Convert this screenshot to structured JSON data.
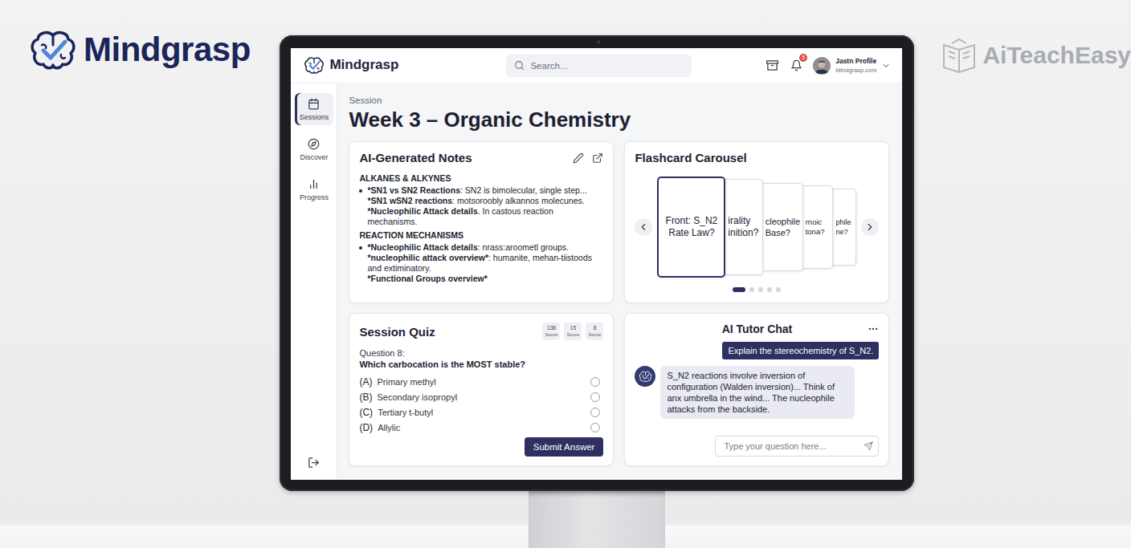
{
  "brand": {
    "name": "Mindgrasp"
  },
  "watermark": {
    "name": "AiTeachEasy"
  },
  "header": {
    "logo": "Mindgrasp",
    "search_placeholder": "Search...",
    "notifications": "5",
    "profile": {
      "name": "Jastn Profile",
      "domain": "Mindgrasp.com"
    }
  },
  "sidebar": {
    "items": [
      {
        "label": "Sessions",
        "selected": true
      },
      {
        "label": "Discover",
        "selected": false
      },
      {
        "label": "Progress",
        "selected": false
      }
    ]
  },
  "session": {
    "eyebrow": "Session",
    "title": "Week 3 – Organic Chemistry"
  },
  "notes": {
    "title": "AI-Generated Notes",
    "sections": [
      {
        "heading": "ALKANES & ALKYNES",
        "lines": [
          {
            "bold": "*SN1 vs SN2 Reactions",
            "text": ": SN2 is bimolecular, single step..."
          },
          {
            "bold": "*SN1 wSN2 reactions",
            "text": ": motsoroobly alkannos molecunes."
          },
          {
            "bold": "*Nucleophilic Attack details",
            "text": ". In castous reaction mechanisms."
          }
        ]
      },
      {
        "heading": "REACTION MECHANISMS",
        "lines": [
          {
            "bold": "*Nucleophilic Attack details",
            "text": ": nrass:aroometl groups."
          },
          {
            "bold": "*nucleophilic attack overview*",
            "text": ": humanite, mehan-tiistoods and extiminatory."
          },
          {
            "bold": "*Functional Groups overview*",
            "text": ""
          }
        ]
      }
    ]
  },
  "flashcards": {
    "title": "Flashcard Carousel",
    "cards": [
      {
        "lines": [
          "Front: S_N2",
          "Rate Law?"
        ],
        "selected": true
      },
      {
        "lines": [
          "irality",
          "inition?"
        ],
        "selected": false
      },
      {
        "lines": [
          "cleophile",
          "Base?"
        ],
        "selected": false
      },
      {
        "lines": [
          "rnoic",
          "tona?"
        ],
        "selected": false
      },
      {
        "lines": [
          "phile",
          "ne?"
        ],
        "selected": false
      }
    ],
    "dots": [
      {
        "selected": true
      },
      {
        "selected": false
      },
      {
        "selected": false
      },
      {
        "selected": false
      },
      {
        "selected": false
      }
    ]
  },
  "quiz": {
    "title": "Session Quiz",
    "scores": [
      {
        "value": "138",
        "label": "Score"
      },
      {
        "value": "15",
        "label": "Score"
      },
      {
        "value": "8",
        "label": "Score"
      }
    ],
    "question_number": "Question 8:",
    "question": "Which carbocation is the MOST stable?",
    "options": [
      {
        "letter": "(A)",
        "text": "Primary methyl",
        "selected": false
      },
      {
        "letter": "(B)",
        "text": "Secondary isopropyl",
        "selected": false
      },
      {
        "letter": "(C)",
        "text": "Tertiary t-butyl",
        "selected": false
      },
      {
        "letter": "(D)",
        "text": "Allylic",
        "selected": false
      }
    ],
    "submit": "Submit Answer"
  },
  "chat": {
    "title": "AI Tutor Chat",
    "messages": [
      {
        "role": "user",
        "text": "Explain the stereochemistry of S_N2."
      },
      {
        "role": "bot",
        "text": "S_N2 reactions involve inversion of configuration (Walden inversion)... Think of anx umbrella in the wind... The nucleophile attacks from the backside."
      }
    ],
    "input_placeholder": "Type your question here..."
  }
}
